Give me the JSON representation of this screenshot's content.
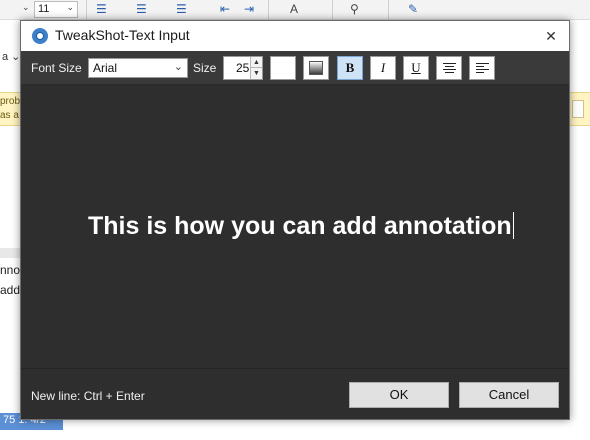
{
  "background_app": {
    "font_size_value": "11",
    "left_dropdown_glyph": "a",
    "warning_lines": [
      "prob",
      "as a"
    ],
    "doc_lines": [
      "nno",
      "add"
    ],
    "status_text": "75 1: 4/2"
  },
  "dialog": {
    "title": "TweakShot-Text Input",
    "close_glyph": "✕"
  },
  "toolbar": {
    "font_size_label": "Font Size",
    "font_family_value": "Arial",
    "size_label": "Size",
    "size_value": "25",
    "bold_label": "B",
    "italic_label": "I",
    "underline_label": "U"
  },
  "canvas": {
    "text": "This is how you can add annotation",
    "text_color": "#ffffff",
    "background_color": "#2e2e2e"
  },
  "footer": {
    "hint": "New line: Ctrl + Enter",
    "ok_label": "OK",
    "cancel_label": "Cancel"
  },
  "icons": [
    "app-logo-icon",
    "close-icon",
    "chevron-down-icon",
    "spin-up-icon",
    "spin-down-icon",
    "text-color-icon",
    "fill-color-icon",
    "align-center-icon",
    "text-wrap-icon"
  ]
}
